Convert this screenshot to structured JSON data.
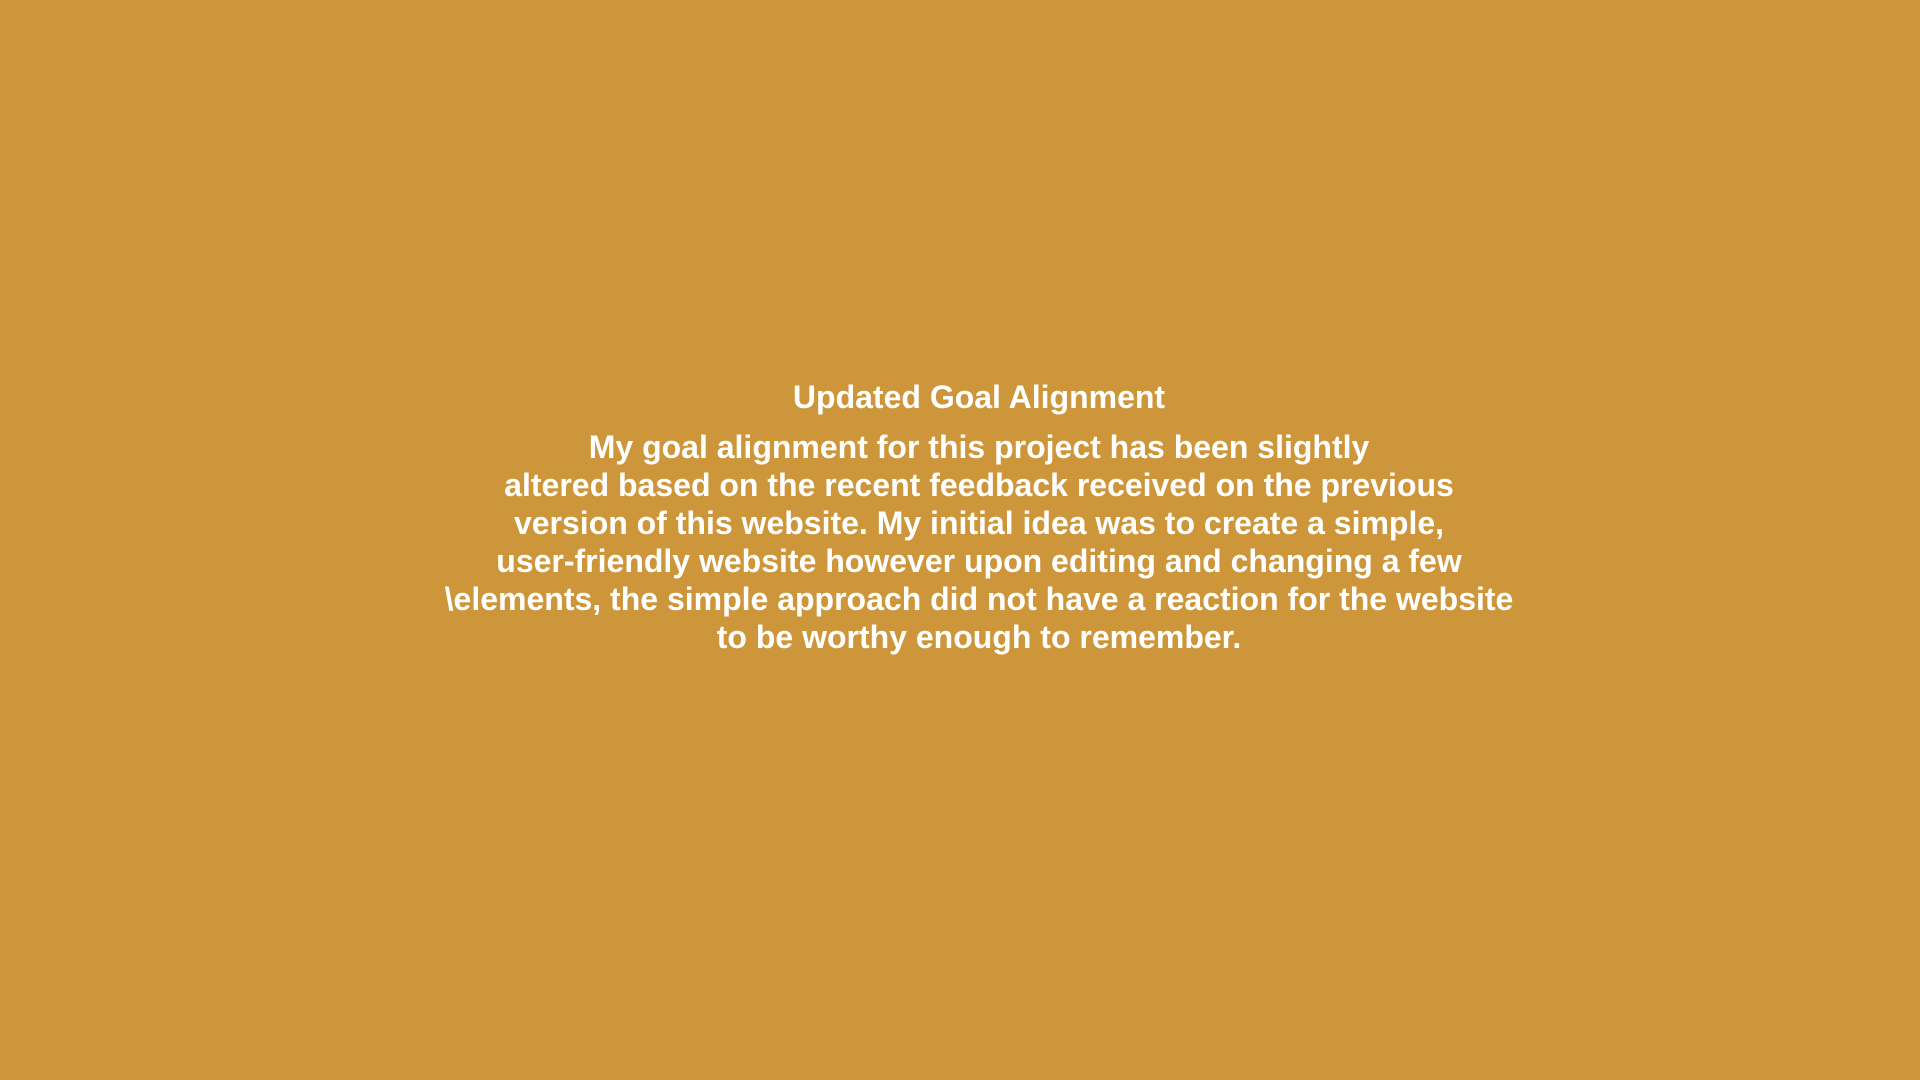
{
  "slide": {
    "background_color": "#CE963B",
    "text_color": "#FFFFFF",
    "title": "Updated Goal Alignment",
    "body_lines": [
      "My goal alignment for this project has been slightly",
      "altered based on the recent feedback received on the previous",
      "version of this website. My initial idea was to create a simple,",
      "user-friendly website however upon editing and changing a few",
      "\\elements, the simple approach did not have a reaction for the website",
      "to be worthy enough to remember."
    ]
  }
}
